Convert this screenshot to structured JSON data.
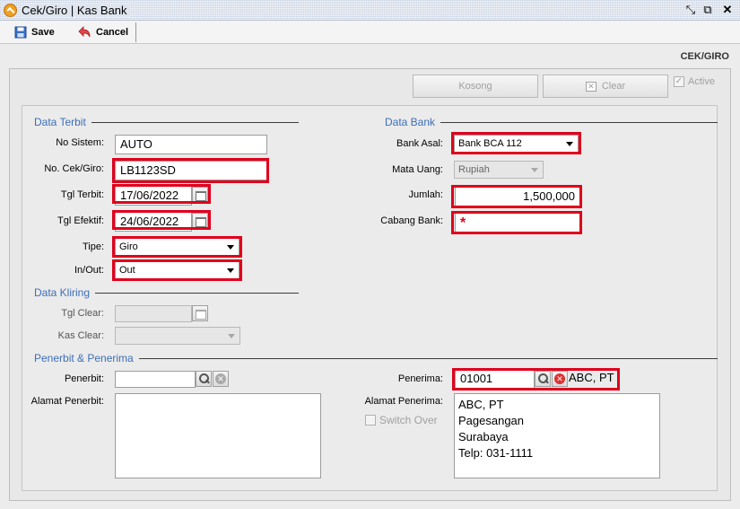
{
  "window": {
    "title": "Cek/Giro | Kas Bank"
  },
  "toolbar": {
    "save_label": "Save",
    "cancel_label": "Cancel"
  },
  "section_title": "CEK/GIRO",
  "actions": {
    "kosong_label": "Kosong",
    "clear_label": "Clear",
    "active_label": "Active"
  },
  "data_terbit": {
    "title": "Data Terbit",
    "no_sistem_label": "No Sistem:",
    "no_sistem_value": "AUTO",
    "no_cek_label": "No. Cek/Giro:",
    "no_cek_value": "LB1123SD",
    "tgl_terbit_label": "Tgl Terbit:",
    "tgl_terbit_value": "17/06/2022",
    "tgl_efektif_label": "Tgl Efektif:",
    "tgl_efektif_value": "24/06/2022",
    "tipe_label": "Tipe:",
    "tipe_value": "Giro",
    "inout_label": "In/Out:",
    "inout_value": "Out"
  },
  "data_bank": {
    "title": "Data Bank",
    "bank_asal_label": "Bank Asal:",
    "bank_asal_value": "Bank BCA 112",
    "mata_uang_label": "Mata Uang:",
    "mata_uang_value": "Rupiah",
    "jumlah_label": "Jumlah:",
    "jumlah_value": "1,500,000",
    "cabang_label": "Cabang Bank:",
    "cabang_value": "*"
  },
  "data_kliring": {
    "title": "Data Kliring",
    "tgl_clear_label": "Tgl Clear:",
    "tgl_clear_value": "",
    "kas_clear_label": "Kas Clear:",
    "kas_clear_value": ""
  },
  "penerbit_penerima": {
    "title": "Penerbit & Penerima",
    "penerbit_label": "Penerbit:",
    "penerbit_value": "",
    "alamat_penerbit_label": "Alamat Penerbit:",
    "alamat_penerbit_value": "",
    "penerima_label": "Penerima:",
    "penerima_code": "01001",
    "penerima_name": "ABC, PT",
    "alamat_penerima_label": "Alamat Penerima:",
    "alamat_penerima_lines": [
      "ABC, PT",
      "Pagesangan",
      "Surabaya",
      "Telp: 031-1111"
    ],
    "switch_over_label": "Switch Over"
  },
  "colors": {
    "highlight": "#e0001b",
    "group_title": "#3d6fb8"
  },
  "icons": [
    "app-icon",
    "restore-icon",
    "popout-icon",
    "close-icon",
    "save-icon",
    "cancel-icon",
    "calendar-icon",
    "search-icon",
    "clear-icon"
  ]
}
